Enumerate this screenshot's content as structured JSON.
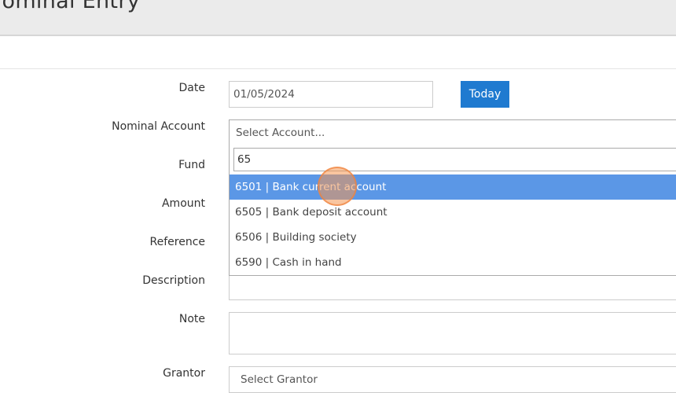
{
  "header": {
    "title": "Nominal Entry"
  },
  "form": {
    "labels": {
      "date": "Date",
      "nominal_account": "Nominal Account",
      "fund": "Fund",
      "amount": "Amount",
      "reference": "Reference",
      "description": "Description",
      "note": "Note",
      "grantor": "Grantor"
    },
    "date_value": "01/05/2024",
    "today_label": "Today",
    "account_select_placeholder": "Select Account...",
    "account_search_value": "65",
    "account_options": [
      {
        "label": "6501 | Bank current account",
        "highlighted": true
      },
      {
        "label": "6505 | Bank deposit account",
        "highlighted": false
      },
      {
        "label": "6506 | Building society",
        "highlighted": false
      },
      {
        "label": "6590 | Cash in hand",
        "highlighted": false
      }
    ],
    "grantor_placeholder": "Select Grantor"
  },
  "colors": {
    "primary": "#1f7ad0",
    "highlight": "#5b97e6",
    "click_indicator": "#f49650"
  }
}
